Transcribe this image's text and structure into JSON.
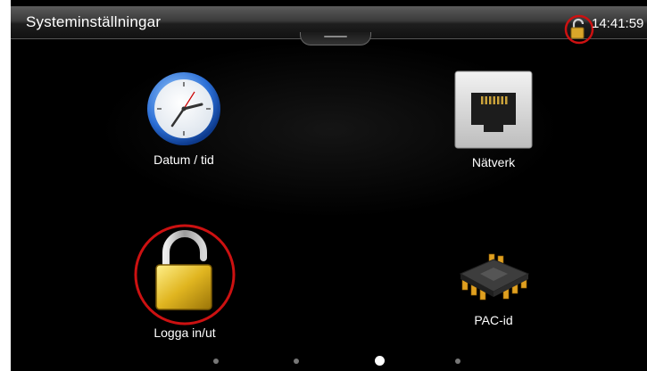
{
  "window": {
    "title": "Systeminställningar",
    "time": "14:41:59"
  },
  "status": {
    "lock_state": "unlocked"
  },
  "tiles": [
    {
      "label": "Datum / tid",
      "icon": "clock-icon"
    },
    {
      "label": "Nätverk",
      "icon": "network-port-icon"
    },
    {
      "label": "Logga in/ut",
      "icon": "padlock-open-icon"
    },
    {
      "label": "PAC-id",
      "icon": "chip-icon"
    }
  ],
  "pager": {
    "pages": 4,
    "current": 3
  },
  "colors": {
    "background": "#000000",
    "highlight_ring": "#cc1111",
    "lock_gold": "#e0b520"
  }
}
